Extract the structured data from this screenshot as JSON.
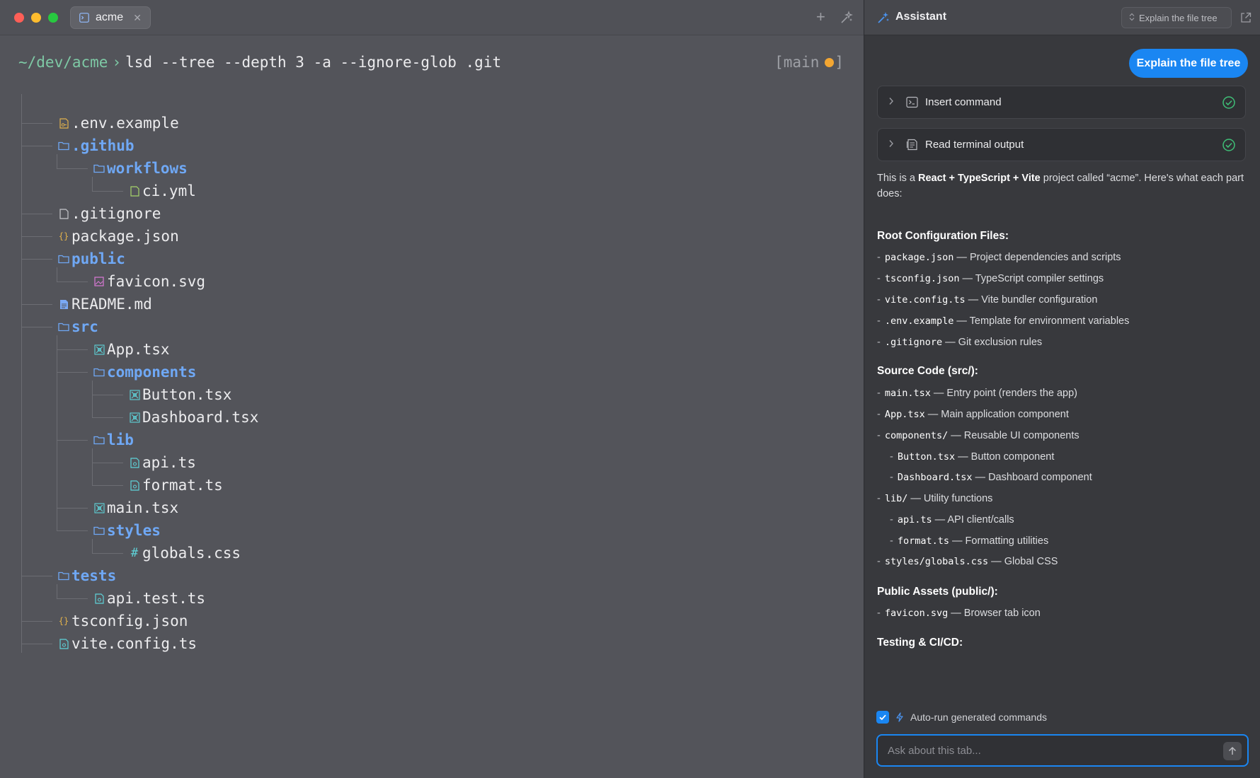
{
  "titlebar": {
    "tab_label": "acme",
    "tab_close": "✕",
    "new_tab": "+"
  },
  "terminal": {
    "cwd": "~/dev/acme",
    "arrow": "›",
    "command": "lsd --tree --depth 3 -a --ignore-glob .git",
    "branch_open": "[main",
    "branch_close": "]",
    "tree": [
      {
        "name": ".env.example",
        "depth": 1,
        "kind": "file",
        "icon": "env-file-icon",
        "icon_color": "#e0b14c"
      },
      {
        "name": ".github",
        "depth": 1,
        "kind": "dir",
        "icon": "folder-icon"
      },
      {
        "name": "workflows",
        "depth": 2,
        "kind": "dir",
        "icon": "folder-icon"
      },
      {
        "name": "ci.yml",
        "depth": 3,
        "kind": "file",
        "icon": "yaml-file-icon",
        "icon_color": "#a6d46a"
      },
      {
        "name": ".gitignore",
        "depth": 1,
        "kind": "file",
        "icon": "file-icon",
        "icon_color": "#c6c7cc"
      },
      {
        "name": "package.json",
        "depth": 1,
        "kind": "file",
        "icon": "json-icon",
        "icon_color": "#e0b14c"
      },
      {
        "name": "public",
        "depth": 1,
        "kind": "dir",
        "icon": "folder-icon"
      },
      {
        "name": "favicon.svg",
        "depth": 2,
        "kind": "file",
        "icon": "image-file-icon",
        "icon_color": "#d97ad6"
      },
      {
        "name": "README.md",
        "depth": 1,
        "kind": "file",
        "icon": "markdown-file-icon",
        "icon_color": "#7aa9f5"
      },
      {
        "name": "src",
        "depth": 1,
        "kind": "dir",
        "icon": "folder-icon"
      },
      {
        "name": "App.tsx",
        "depth": 2,
        "kind": "file",
        "icon": "react-icon",
        "icon_color": "#5fd3d9"
      },
      {
        "name": "components",
        "depth": 2,
        "kind": "dir",
        "icon": "folder-icon"
      },
      {
        "name": "Button.tsx",
        "depth": 3,
        "kind": "file",
        "icon": "react-icon",
        "icon_color": "#5fd3d9"
      },
      {
        "name": "Dashboard.tsx",
        "depth": 3,
        "kind": "file",
        "icon": "react-icon",
        "icon_color": "#5fd3d9"
      },
      {
        "name": "lib",
        "depth": 2,
        "kind": "dir",
        "icon": "folder-icon"
      },
      {
        "name": "api.ts",
        "depth": 3,
        "kind": "file",
        "icon": "ts-file-icon",
        "icon_color": "#5fd3d9"
      },
      {
        "name": "format.ts",
        "depth": 3,
        "kind": "file",
        "icon": "ts-file-icon",
        "icon_color": "#5fd3d9"
      },
      {
        "name": "main.tsx",
        "depth": 2,
        "kind": "file",
        "icon": "react-icon",
        "icon_color": "#5fd3d9"
      },
      {
        "name": "styles",
        "depth": 2,
        "kind": "dir",
        "icon": "folder-icon"
      },
      {
        "name": "globals.css",
        "depth": 3,
        "kind": "file",
        "icon": "css-hash-icon",
        "icon_color": "#5fd3d9"
      },
      {
        "name": "tests",
        "depth": 1,
        "kind": "dir",
        "icon": "folder-icon"
      },
      {
        "name": "api.test.ts",
        "depth": 2,
        "kind": "file",
        "icon": "ts-file-icon",
        "icon_color": "#5fd3d9"
      },
      {
        "name": "tsconfig.json",
        "depth": 1,
        "kind": "file",
        "icon": "json-icon",
        "icon_color": "#e0b14c"
      },
      {
        "name": "vite.config.ts",
        "depth": 1,
        "kind": "file",
        "icon": "ts-file-icon",
        "icon_color": "#5fd3d9"
      }
    ]
  },
  "assistant": {
    "title": "Assistant",
    "header_pill": "Explain the file tree",
    "user_message": "Explain the file tree",
    "tools": [
      {
        "label": "Insert command"
      },
      {
        "label": "Read terminal output"
      }
    ],
    "intro_pre": "This is a ",
    "intro_bold": "React + TypeScript + Vite",
    "intro_post": " project called “acme”. Here's what each part does:",
    "sections": [
      {
        "heading": "Root Configuration Files:",
        "items": [
          {
            "code": "package.json",
            "text": " — Project dependencies and scripts",
            "sub": false
          },
          {
            "code": "tsconfig.json",
            "text": " — TypeScript compiler settings",
            "sub": false
          },
          {
            "code": "vite.config.ts",
            "text": " — Vite bundler configuration",
            "sub": false
          },
          {
            "code": ".env.example",
            "text": " — Template for environment variables",
            "sub": false
          },
          {
            "code": ".gitignore",
            "text": " — Git exclusion rules",
            "sub": false
          }
        ]
      },
      {
        "heading": "Source Code (src/):",
        "items": [
          {
            "code": "main.tsx",
            "text": " — Entry point (renders the app)",
            "sub": false
          },
          {
            "code": "App.tsx",
            "text": " — Main application component",
            "sub": false
          },
          {
            "code": "components/",
            "text": " — Reusable UI components",
            "sub": false
          },
          {
            "code": "Button.tsx",
            "text": " — Button component",
            "sub": true
          },
          {
            "code": "Dashboard.tsx",
            "text": " — Dashboard component",
            "sub": true
          },
          {
            "code": "lib/",
            "text": " — Utility functions",
            "sub": false
          },
          {
            "code": "api.ts",
            "text": " — API client/calls",
            "sub": true
          },
          {
            "code": "format.ts",
            "text": " — Formatting utilities",
            "sub": true
          },
          {
            "code": "styles/globals.css",
            "text": " — Global CSS",
            "sub": false
          }
        ]
      },
      {
        "heading": "Public Assets (public/):",
        "items": [
          {
            "code": "favicon.svg",
            "text": " — Browser tab icon",
            "sub": false
          }
        ]
      },
      {
        "heading": "Testing & CI/CD:",
        "items": []
      }
    ],
    "autorun_label": "Auto-run generated commands",
    "autorun_checked": true,
    "ask_placeholder": "Ask about this tab..."
  },
  "colors": {
    "accent": "#1a86f2",
    "dir": "#6fa8f5",
    "prompt": "#7ec9a5",
    "branch_dot": "#f3a632",
    "check": "#3fbf77"
  }
}
